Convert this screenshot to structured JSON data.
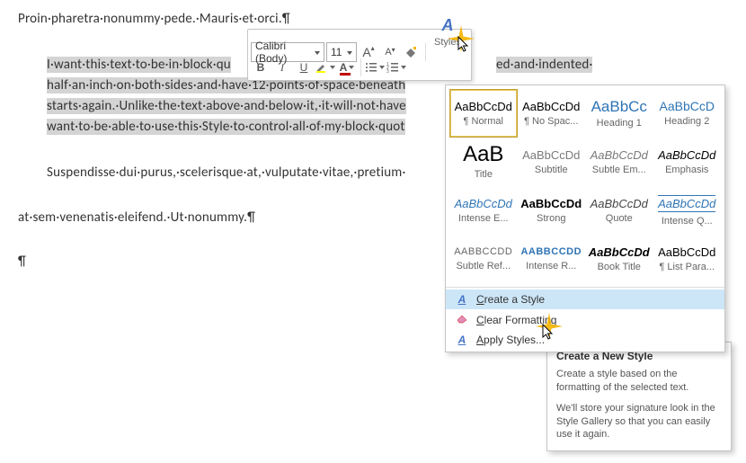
{
  "doc": {
    "para1": "Proin·pharetra·nonummy·pede.·Mauris·et·orci.",
    "sel_l1": "I·want·this·text·to·be·in·block·qu",
    "sel_l1_after": "ed·and·indented·",
    "sel_l2": "half·an·inch·on·both·sides·and·have·12·points·of·space·beneath",
    "sel_l3": "starts·again.·Unlike·the·text·above·and·below·it,·it·will·not·have",
    "sel_l4": "want·to·be·able·to·use·this·Style·to·control·all·of·my·block·quot",
    "after1": "Suspendisse·dui·purus,·scelerisque·at,·vulputate·vitae,·pretium·",
    "after2": "at·sem·venenatis·eleifend.·Ut·nonummy."
  },
  "toolbar": {
    "font": "Calibri (Body)",
    "size": "11",
    "grow": "A",
    "shrink": "A",
    "bold": "B",
    "italic": "I",
    "underline": "U",
    "styles_label": "Styles"
  },
  "gallery": {
    "rows": [
      [
        {
          "preview": "AaBbCcDd",
          "name": "¶ Normal",
          "css": "color:#000"
        },
        {
          "preview": "AaBbCcDd",
          "name": "¶ No Spac...",
          "css": "color:#000"
        },
        {
          "preview": "AaBbCc",
          "name": "Heading 1",
          "css": "color:#2E74B5;font-size:17px"
        },
        {
          "preview": "AaBbCcD",
          "name": "Heading 2",
          "css": "color:#2E74B5;font-size:14px"
        }
      ],
      [
        {
          "preview": "AaB",
          "name": "Title",
          "css": "color:#000;font-size:24px"
        },
        {
          "preview": "AaBbCcDd",
          "name": "Subtitle",
          "css": "color:#7a7a7a"
        },
        {
          "preview": "AaBbCcDd",
          "name": "Subtle Em...",
          "css": "color:#7a7a7a;font-style:italic"
        },
        {
          "preview": "AaBbCcDd",
          "name": "Emphasis",
          "css": "color:#000;font-style:italic"
        }
      ],
      [
        {
          "preview": "AaBbCcDd",
          "name": "Intense E...",
          "css": "color:#2E74B5;font-style:italic"
        },
        {
          "preview": "AaBbCcDd",
          "name": "Strong",
          "css": "color:#000;font-weight:bold"
        },
        {
          "preview": "AaBbCcDd",
          "name": "Quote",
          "css": "color:#444;font-style:italic"
        },
        {
          "preview": "AaBbCcDd",
          "name": "Intense Q...",
          "css": "color:#2E74B5;font-style:italic;border-bottom:1px solid #2E74B5;border-top:1px solid #2E74B5;padding:2px 0"
        }
      ],
      [
        {
          "preview": "AABBCCDD",
          "name": "Subtle Ref...",
          "css": "color:#666;font-size:11px;letter-spacing:.5px"
        },
        {
          "preview": "AABBCCDD",
          "name": "Intense R...",
          "css": "color:#2E74B5;font-size:11px;letter-spacing:.5px;font-weight:bold"
        },
        {
          "preview": "AaBbCcDd",
          "name": "Book Title",
          "css": "color:#000;font-style:italic;font-weight:bold"
        },
        {
          "preview": "AaBbCcDd",
          "name": "¶ List Para...",
          "css": "color:#000"
        }
      ]
    ],
    "menu": {
      "create": "Create a Style",
      "clear": "Clear Formatting",
      "apply": "Apply Styles..."
    }
  },
  "tooltip": {
    "title": "Create a New Style",
    "p1": "Create a style based on the formatting of the selected text.",
    "p2": "We'll store your signature look in the Style Gallery so that you can easily use it again."
  }
}
